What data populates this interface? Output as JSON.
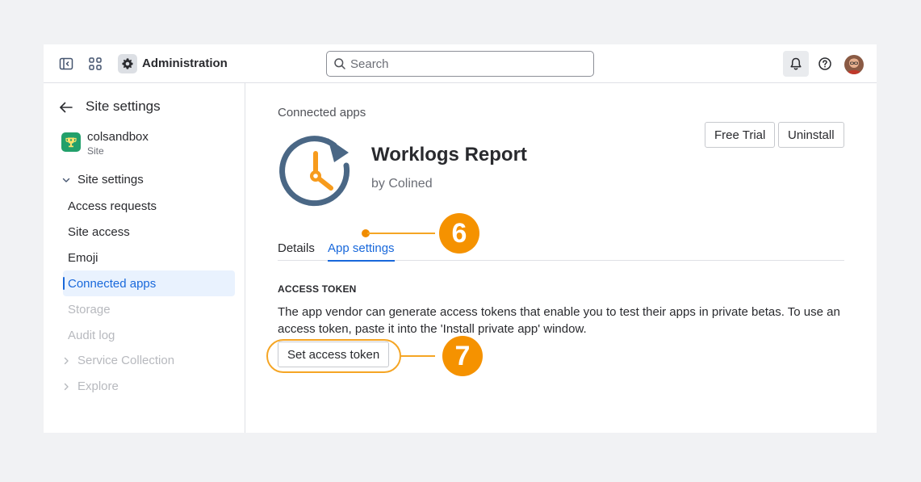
{
  "topbar": {
    "title": "Administration",
    "search_placeholder": "Search"
  },
  "sidebar": {
    "title": "Site settings",
    "site": {
      "name": "colsandbox",
      "type": "Site"
    },
    "group_label": "Site settings",
    "items": [
      {
        "label": "Access requests",
        "state": "normal"
      },
      {
        "label": "Site access",
        "state": "normal"
      },
      {
        "label": "Emoji",
        "state": "normal"
      },
      {
        "label": "Connected apps",
        "state": "active"
      },
      {
        "label": "Storage",
        "state": "disabled"
      },
      {
        "label": "Audit log",
        "state": "disabled"
      }
    ],
    "collapsed_groups": [
      {
        "label": "Service Collection"
      },
      {
        "label": "Explore"
      }
    ]
  },
  "main": {
    "breadcrumb": "Connected apps",
    "app_name": "Worklogs Report",
    "app_vendor": "by Colined",
    "actions": {
      "free_trial": "Free Trial",
      "uninstall": "Uninstall"
    },
    "tabs": [
      {
        "label": "Details",
        "active": false
      },
      {
        "label": "App settings",
        "active": true
      }
    ],
    "section_heading": "ACCESS TOKEN",
    "section_description": "The app vendor can generate access tokens that enable you to test their apps in private betas. To use an access token, paste it into the 'Install private app' window.",
    "token_button": "Set access token"
  },
  "annotations": {
    "step_a": "6",
    "step_b": "7"
  },
  "colors": {
    "accent_blue": "#1868db",
    "annotation_orange": "#f59200",
    "logo_slate": "#4a6785",
    "logo_orange": "#f79b1c",
    "site_logo_green": "#22a06b"
  }
}
